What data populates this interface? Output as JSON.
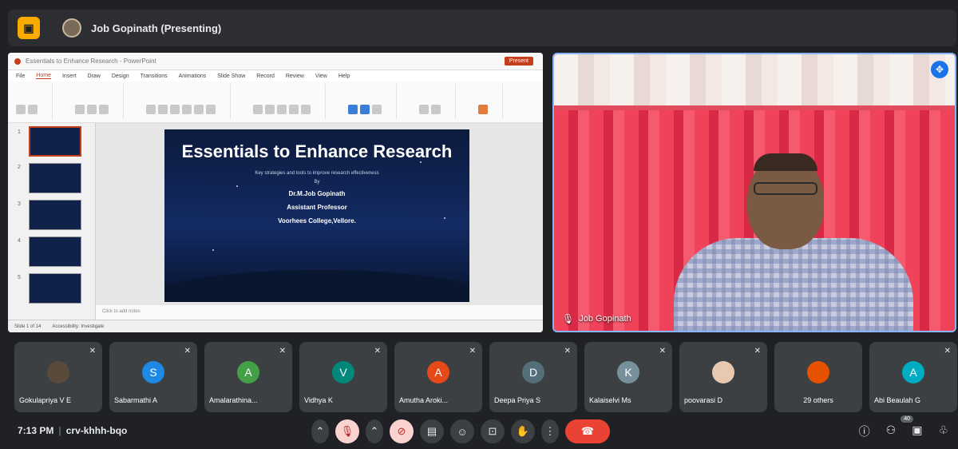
{
  "meeting": {
    "presenter_label": "Job Gopinath (Presenting)",
    "time": "7:13 PM",
    "code": "crv-khhh-bqo"
  },
  "presentation": {
    "app_title": "Essentials to Enhance Research - PowerPoint",
    "menu": [
      "File",
      "Home",
      "Insert",
      "Draw",
      "Design",
      "Transitions",
      "Animations",
      "Slide Show",
      "Record",
      "Review",
      "View",
      "Help"
    ],
    "present_label": "Present",
    "slide_title": "Essentials to Enhance Research",
    "slide_subtitle": "Key strategies and tools to improve research effectiveness",
    "slide_by": "By",
    "slide_author": "Dr.M.Job Gopinath",
    "slide_role": "Assistant Professor",
    "slide_org": "Voorhees College,Vellore.",
    "notes_placeholder": "Click to add notes",
    "status_slide": "Slide 1 of 14",
    "status_access": "Accessibility: Investigate"
  },
  "camera": {
    "name": "Job Gopinath"
  },
  "participants": [
    {
      "name": "Gokulapriya V E",
      "initial": "",
      "color": "#5a4a3a"
    },
    {
      "name": "Sabarmathi A",
      "initial": "S",
      "color": "#1e88e5"
    },
    {
      "name": "Amalarathina...",
      "initial": "A",
      "color": "#43a047"
    },
    {
      "name": "Vidhya K",
      "initial": "V",
      "color": "#00897b"
    },
    {
      "name": "Amutha Aroki...",
      "initial": "A",
      "color": "#e64a19"
    },
    {
      "name": "Deepa Priya S",
      "initial": "D",
      "color": "#546e7a"
    },
    {
      "name": "Kalaiselvi Ms",
      "initial": "K",
      "color": "#78909c"
    },
    {
      "name": "poovarasi D",
      "initial": "",
      "color": "#e8c9b0"
    },
    {
      "name": "29 others",
      "initial": "",
      "color": "#e65100"
    },
    {
      "name": "Abi Beaulah G",
      "initial": "A",
      "color": "#00acc1"
    }
  ],
  "controls": {
    "people_count": "40"
  }
}
